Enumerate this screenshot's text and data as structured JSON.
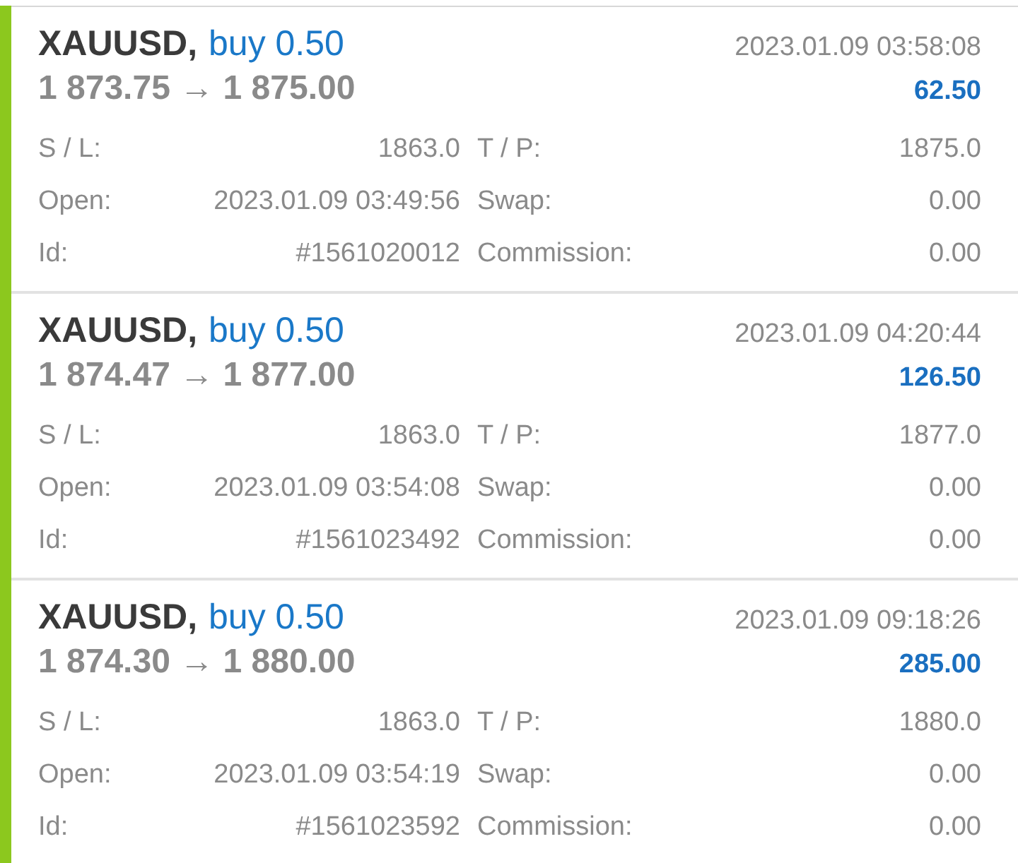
{
  "trades": [
    {
      "symbol": "XAUUSD,",
      "order": "buy 0.50",
      "time": "2023.01.09 03:58:08",
      "prices": "1 873.75 → 1 875.00",
      "profit": "62.50",
      "details": [
        {
          "label": "S / L:",
          "value": "1863.0"
        },
        {
          "label": "T / P:",
          "value": "1875.0"
        },
        {
          "label": "Open:",
          "value": "2023.01.09 03:49:56"
        },
        {
          "label": "Swap:",
          "value": "0.00"
        },
        {
          "label": "Id:",
          "value": "#1561020012"
        },
        {
          "label": "Commission:",
          "value": "0.00"
        }
      ]
    },
    {
      "symbol": "XAUUSD,",
      "order": "buy 0.50",
      "time": "2023.01.09 04:20:44",
      "prices": "1 874.47 → 1 877.00",
      "profit": "126.50",
      "details": [
        {
          "label": "S / L:",
          "value": "1863.0"
        },
        {
          "label": "T / P:",
          "value": "1877.0"
        },
        {
          "label": "Open:",
          "value": "2023.01.09 03:54:08"
        },
        {
          "label": "Swap:",
          "value": "0.00"
        },
        {
          "label": "Id:",
          "value": "#1561023492"
        },
        {
          "label": "Commission:",
          "value": "0.00"
        }
      ]
    },
    {
      "symbol": "XAUUSD,",
      "order": "buy 0.50",
      "time": "2023.01.09 09:18:26",
      "prices": "1 874.30 → 1 880.00",
      "profit": "285.00",
      "details": [
        {
          "label": "S / L:",
          "value": "1863.0"
        },
        {
          "label": "T / P:",
          "value": "1880.0"
        },
        {
          "label": "Open:",
          "value": "2023.01.09 03:54:19"
        },
        {
          "label": "Swap:",
          "value": "0.00"
        },
        {
          "label": "Id:",
          "value": "#1561023592"
        },
        {
          "label": "Commission:",
          "value": "0.00"
        }
      ]
    }
  ]
}
